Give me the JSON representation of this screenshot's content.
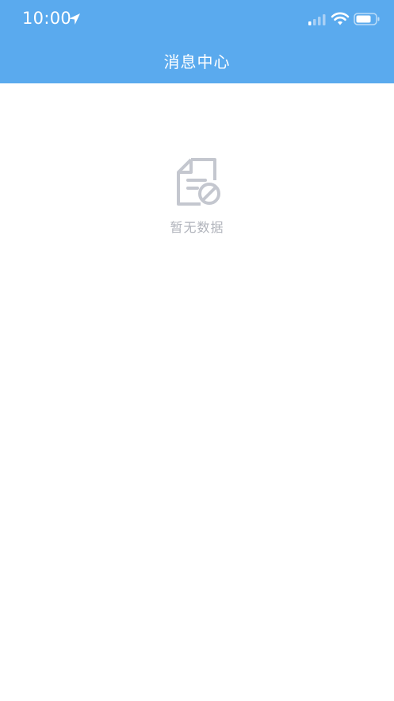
{
  "status_bar": {
    "time": "10:00",
    "icons": [
      "location-arrow-icon",
      "cellular-signal-icon",
      "wifi-icon",
      "battery-icon"
    ]
  },
  "nav": {
    "title": "消息中心"
  },
  "empty_state": {
    "icon": "no-data-document-icon",
    "text": "暂无数据"
  },
  "colors": {
    "header_bg": "#5aaaee",
    "header_text": "#ffffff",
    "empty_text": "#b0b3bb",
    "empty_icon": "#c4c7cf"
  }
}
